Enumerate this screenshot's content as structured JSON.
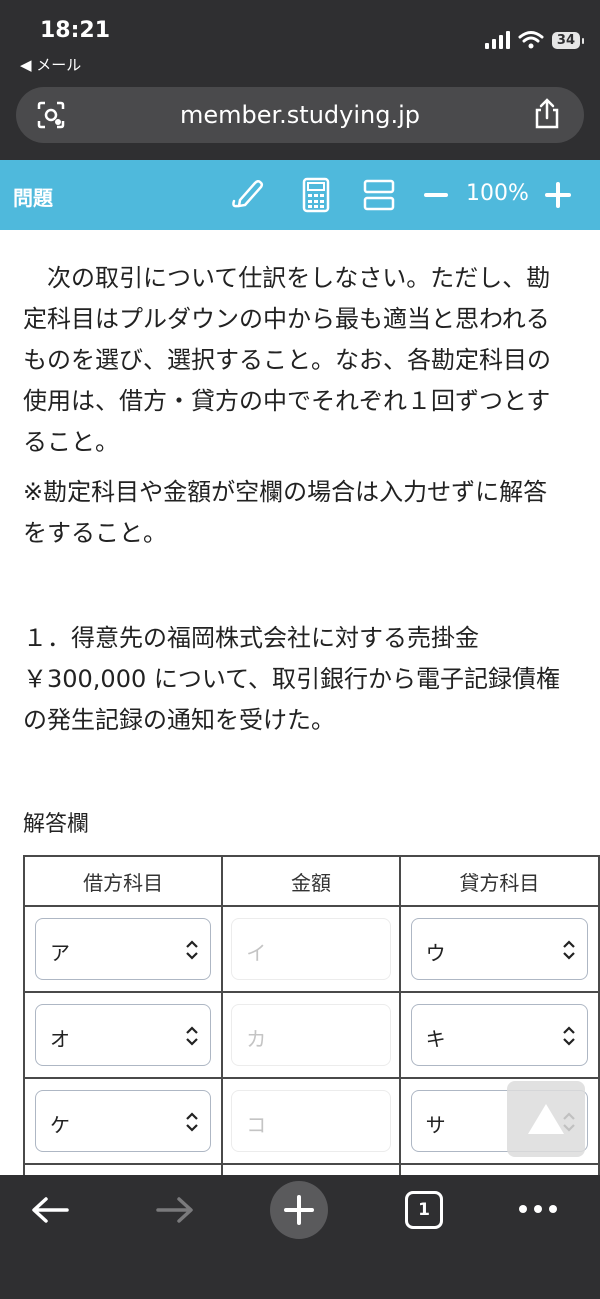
{
  "status_bar": {
    "time": "18:21",
    "back_app": "◀ メール",
    "battery": "34"
  },
  "browser": {
    "url": "member.studying.jp",
    "tab_count": "1"
  },
  "toolbar": {
    "title": "問題",
    "zoom": "100%"
  },
  "question": {
    "instruction": "　次の取引について仕訳をしなさい。ただし、勘定科目はプルダウンの中から最も適当と思われるものを選び、選択すること。なお、各勘定科目の使用は、借方・貸方の中でそれぞれ１回ずつとすること。",
    "note": "※勘定科目や金額が空欄の場合は入力せずに解答をすること。",
    "transaction": "１．得意先の福岡株式会社に対する売掛金￥300,000 について、取引銀行から電子記録債権の発生記録の通知を受けた。"
  },
  "answer": {
    "label": "解答欄",
    "headers": [
      "借方科目",
      "金額",
      "貸方科目"
    ],
    "rows": [
      {
        "debit": "ア",
        "amount_placeholder": "イ",
        "credit": "ウ"
      },
      {
        "debit": "オ",
        "amount_placeholder": "カ",
        "credit": "キ"
      },
      {
        "debit": "ケ",
        "amount_placeholder": "コ",
        "credit": "サ"
      }
    ]
  },
  "icons": {
    "url_left": "screen-capture-icon",
    "url_right": "share-icon",
    "toolbar": [
      "pen-icon",
      "calculator-icon",
      "split-view-icon",
      "zoom-out-icon",
      "zoom-in-icon"
    ],
    "scroll": "scroll-to-top-icon",
    "bottom_nav": [
      "back-arrow-icon",
      "forward-arrow-icon",
      "new-tab-icon",
      "tabs-icon",
      "more-icon"
    ]
  },
  "colors": {
    "toolbar": "#4fb9dc",
    "chrome": "#2f2f31"
  }
}
